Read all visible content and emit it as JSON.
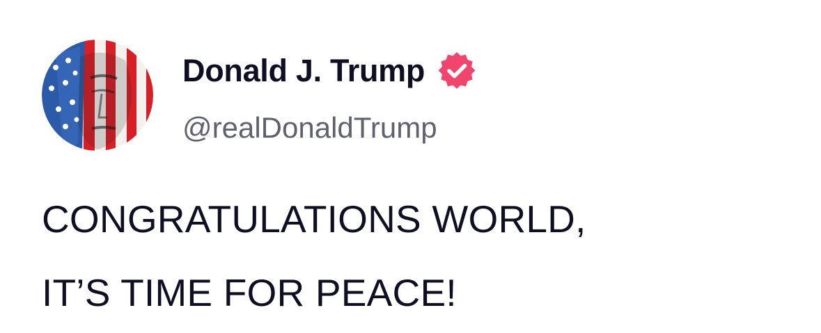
{
  "author": {
    "display_name": "Donald J. Trump",
    "handle": "@realDonaldTrump",
    "verified": true,
    "verified_icon": "verified-badge-icon",
    "avatar_icon": "flag-face-avatar"
  },
  "post": {
    "lines": [
      "CONGRATULATIONS WORLD,",
      "IT’S TIME FOR PEACE!"
    ]
  },
  "colors": {
    "badge": "#f2456e",
    "text": "#0f0f23",
    "handle": "#606070"
  }
}
